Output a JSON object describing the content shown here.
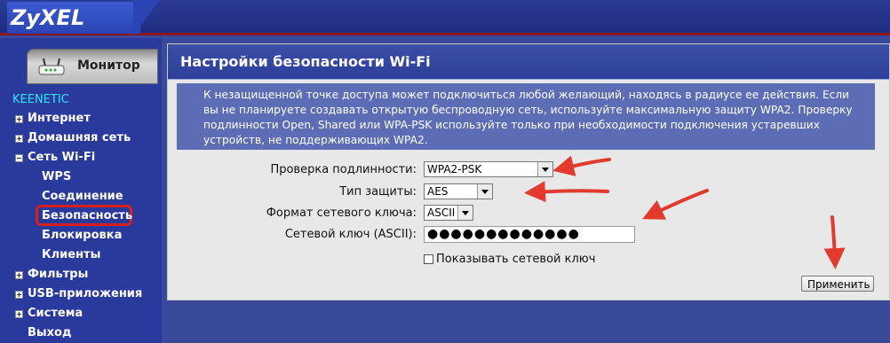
{
  "brand": {
    "logo": "ZyXEL"
  },
  "sidebar": {
    "monitor_label": "Монитор",
    "section_title": "KEENETIC",
    "items": [
      {
        "label": "Интернет",
        "expander": "plus"
      },
      {
        "label": "Домашняя сеть",
        "expander": "plus"
      },
      {
        "label": "Сеть Wi-Fi",
        "expander": "minus"
      },
      {
        "label": "WPS"
      },
      {
        "label": "Соединение"
      },
      {
        "label": "Безопасность",
        "selected": true
      },
      {
        "label": "Блокировка"
      },
      {
        "label": "Клиенты"
      },
      {
        "label": "Фильтры",
        "expander": "plus"
      },
      {
        "label": "USB-приложения",
        "expander": "plus"
      },
      {
        "label": "Система",
        "expander": "plus"
      },
      {
        "label": "Выход"
      }
    ]
  },
  "main": {
    "title": "Настройки безопасности Wi-Fi",
    "note": "К незащищенной точке доступа может подключиться любой желающий, находясь в радиусе ее действия. Если вы не планируете создавать открытую беспроводную сеть, используйте максимальную защиту WPA2. Проверку подлинности Open, Shared или WPA-PSK используйте только при необходимости подключения устаревших устройств, не поддерживающих WPA2.",
    "fields": {
      "auth_label": "Проверка подлинности:",
      "auth_value": "WPA2-PSK",
      "protection_label": "Тип защиты:",
      "protection_value": "AES",
      "key_format_label": "Формат сетевого ключа:",
      "key_format_value": "ASCII",
      "key_label": "Сетевой ключ (ASCII):",
      "key_value": "●●●●●●●●●●●●●",
      "show_key_label": "Показывать сетевой ключ",
      "show_key_checked": false
    },
    "apply_label": "Применить"
  },
  "colors": {
    "sidebar_bg": "#2a3a9c",
    "accent_cyan": "#2fe6ff",
    "highlight_red": "#d62020",
    "note_bg": "#5c6db5"
  }
}
